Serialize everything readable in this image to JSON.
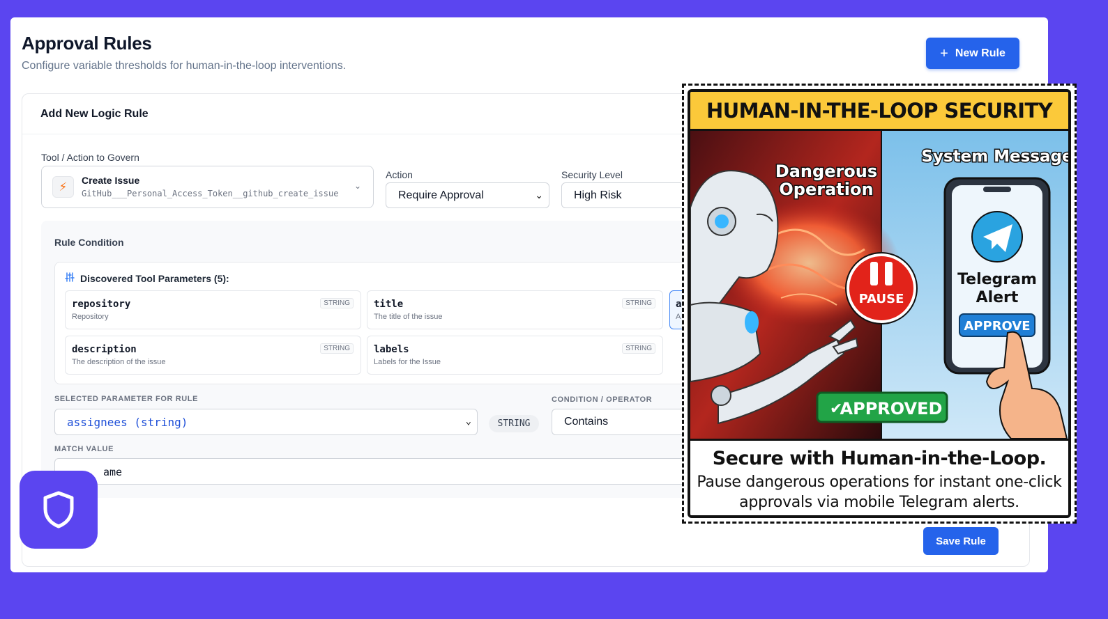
{
  "header": {
    "title": "Approval Rules",
    "subtitle": "Configure variable thresholds for human-in-the-loop interventions.",
    "new_rule_label": "New Rule"
  },
  "form": {
    "card_title": "Add New Logic Rule",
    "tool_label": "Tool / Action to Govern",
    "tool_name": "Create Issue",
    "tool_id": "GitHub___Personal_Access_Token__github_create_issue",
    "action_label": "Action",
    "action_value": "Require Approval",
    "security_label": "Security Level",
    "security_value": "High Risk",
    "rule_condition_label": "Rule Condition",
    "params_title": "Discovered Tool Parameters (5):",
    "params": [
      {
        "name": "repository",
        "desc": "Repository",
        "type": "STRING"
      },
      {
        "name": "title",
        "desc": "The title of the issue",
        "type": "STRING"
      },
      {
        "name": "description",
        "desc": "The description of the issue",
        "type": "STRING"
      },
      {
        "name": "labels",
        "desc": "Labels for the Issue",
        "type": "STRING"
      }
    ],
    "partial_param_name": "a",
    "partial_param_desc": "A",
    "selected_param_label": "SELECTED PARAMETER FOR RULE",
    "selected_param_value": "assignees (string)",
    "selected_param_type": "STRING",
    "operator_label": "CONDITION / OPERATOR",
    "operator_value": "Contains",
    "match_label": "MATCH VALUE",
    "match_value": "ame",
    "save_label": "Save Rule"
  },
  "overlay": {
    "banner": "HUMAN-IN-THE-LOOP SECURITY",
    "danger_line1": "Dangerous",
    "danger_line2": "Operation",
    "pause_label": "PAUSE",
    "system_message": "System Message",
    "alert_line1": "Telegram",
    "alert_line2": "Alert",
    "approve_label": "APPROVE",
    "approved_label": "APPROVED",
    "caption_heading": "Secure with Human-in-the-Loop.",
    "caption_line1": "Pause dangerous operations for instant one-click",
    "caption_line2": "approvals via mobile Telegram alerts."
  },
  "icons": {
    "tool": "lightning-icon",
    "params": "sliders-icon",
    "logo": "shield-icon",
    "new_rule": "plus-icon"
  },
  "colors": {
    "background": "#5b45f0",
    "primary": "#2563eb",
    "banner": "#fbc93a",
    "danger": "#dc2626",
    "success": "#22a447"
  }
}
